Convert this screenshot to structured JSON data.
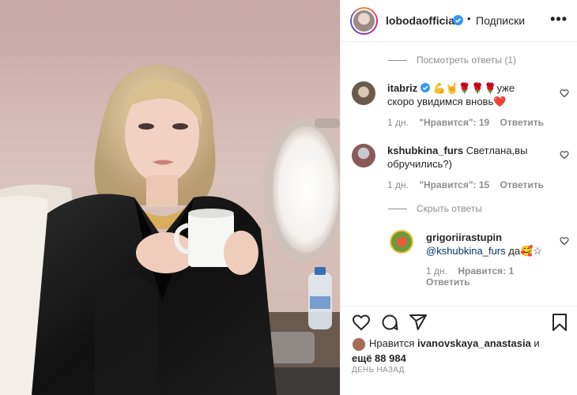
{
  "post": {
    "username": "lobodaofficial",
    "dot": "•",
    "follow_label": "Подписки",
    "more_icon": "•••"
  },
  "comments": {
    "view_replies_label": "Посмотреть ответы (1)",
    "hide_replies_label": "Скрыть ответы",
    "items": [
      {
        "username": "itabriz",
        "text_line1": "💪🤘🌹🌹🌹уже",
        "text_line2": "скоро увидимся вновь❤️",
        "time": "1 дн.",
        "likes": "\"Нравится\": 19",
        "reply": "Ответить"
      },
      {
        "username": "kshubkina_furs",
        "text_line1": "Светлана,вы",
        "text_line2": "обручились?)",
        "time": "1 дн.",
        "likes": "\"Нравится\": 15",
        "reply": "Ответить"
      }
    ],
    "reply": {
      "username": "grigoriirastupin",
      "mention": "@kshubkina_furs",
      "text": " да🥰☆",
      "time": "1 дн.",
      "likes": "Нравится: 1",
      "reply": "Ответить"
    }
  },
  "likes": {
    "prefix": "Нравится ",
    "user": "ivanovskaya_anastasia",
    "and": " и",
    "more": "ещё 88 984"
  },
  "date_label": "ДЕНЬ НАЗАД",
  "colors": {
    "verified": "#3897f0",
    "heart_red": "#ed4956",
    "text": "#262626",
    "muted": "#8e8e8e"
  }
}
